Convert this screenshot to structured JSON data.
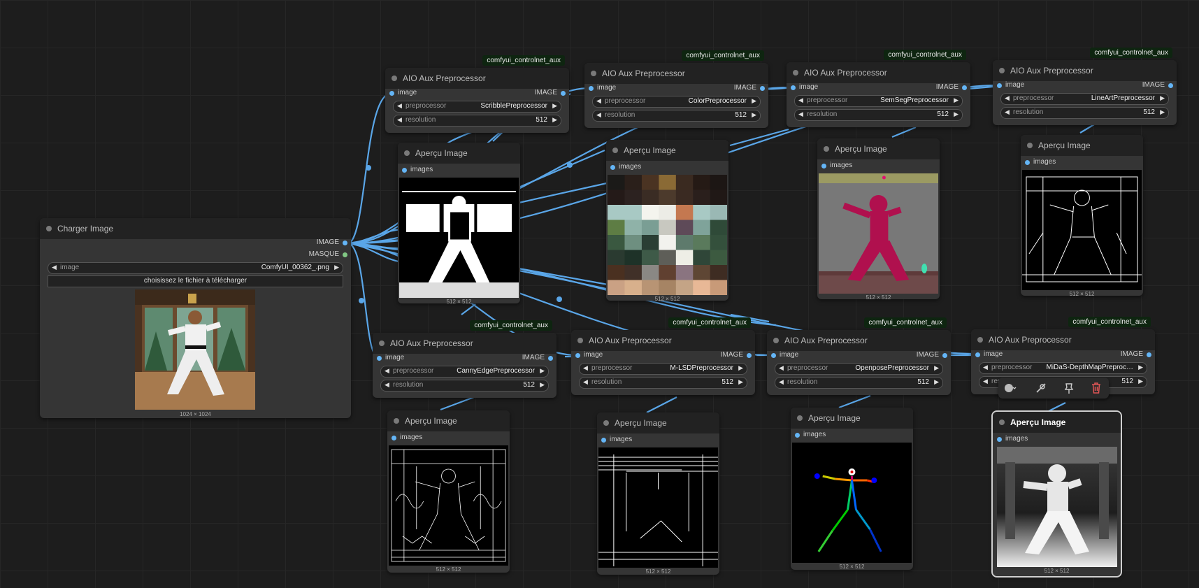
{
  "canvas": {
    "theme": "dark",
    "link_color": "#5aa6e8"
  },
  "loader": {
    "title": "Charger Image",
    "out_image": "IMAGE",
    "out_mask": "MASQUE",
    "widget_name": "image",
    "widget_value": "ComfyUI_00362_.png",
    "upload_label": "choisissez le fichier à télécharger",
    "dims": "1024 × 1024"
  },
  "nodes": [
    {
      "badge": "comfyui_controlnet_aux",
      "title": "AIO Aux Preprocessor",
      "in_label": "image",
      "out_label": "IMAGE",
      "pre_name": "preprocessor",
      "pre_value": "ScribblePreprocessor",
      "res_name": "resolution",
      "res_value": "512"
    },
    {
      "badge": "comfyui_controlnet_aux",
      "title": "AIO Aux Preprocessor",
      "in_label": "image",
      "out_label": "IMAGE",
      "pre_name": "preprocessor",
      "pre_value": "ColorPreprocessor",
      "res_name": "resolution",
      "res_value": "512"
    },
    {
      "badge": "comfyui_controlnet_aux",
      "title": "AIO Aux Preprocessor",
      "in_label": "image",
      "out_label": "IMAGE",
      "pre_name": "preprocessor",
      "pre_value": "SemSegPreprocessor",
      "res_name": "resolution",
      "res_value": "512"
    },
    {
      "badge": "comfyui_controlnet_aux",
      "title": "AIO Aux Preprocessor",
      "in_label": "image",
      "out_label": "IMAGE",
      "pre_name": "preprocessor",
      "pre_value": "LineArtPreprocessor",
      "res_name": "resolution",
      "res_value": "512"
    },
    {
      "badge": "comfyui_controlnet_aux",
      "title": "AIO Aux Preprocessor",
      "in_label": "image",
      "out_label": "IMAGE",
      "pre_name": "preprocessor",
      "pre_value": "CannyEdgePreprocessor",
      "res_name": "resolution",
      "res_value": "512"
    },
    {
      "badge": "comfyui_controlnet_aux",
      "title": "AIO Aux Preprocessor",
      "in_label": "image",
      "out_label": "IMAGE",
      "pre_name": "preprocessor",
      "pre_value": "M-LSDPreprocessor",
      "res_name": "resolution",
      "res_value": "512"
    },
    {
      "badge": "comfyui_controlnet_aux",
      "title": "AIO Aux Preprocessor",
      "in_label": "image",
      "out_label": "IMAGE",
      "pre_name": "preprocessor",
      "pre_value": "OpenposePreprocessor",
      "res_name": "resolution",
      "res_value": "512"
    },
    {
      "badge": "comfyui_controlnet_aux",
      "title": "AIO Aux Preprocessor",
      "in_label": "image",
      "out_label": "IMAGE",
      "pre_name": "preprocessor",
      "pre_value": "MiDaS-DepthMapPreproc…",
      "res_name": "resolution",
      "res_value": "512"
    }
  ],
  "previews": [
    {
      "title": "Aperçu Image",
      "in_label": "images",
      "dims": "512 × 512"
    },
    {
      "title": "Aperçu Image",
      "in_label": "images",
      "dims": "512 × 512"
    },
    {
      "title": "Aperçu Image",
      "in_label": "images",
      "dims": "512 × 512"
    },
    {
      "title": "Aperçu Image",
      "in_label": "images",
      "dims": "512 × 512"
    },
    {
      "title": "Aperçu Image",
      "in_label": "images",
      "dims": "512 × 512"
    },
    {
      "title": "Aperçu Image",
      "in_label": "images",
      "dims": "512 × 512"
    },
    {
      "title": "Aperçu Image",
      "in_label": "images",
      "dims": "512 × 512"
    },
    {
      "title": "Aperçu Image",
      "in_label": "images",
      "dims": "512 × 512"
    }
  ],
  "toolbar": {
    "icons": [
      "color-picker-icon",
      "bypass-icon",
      "pin-icon",
      "delete-icon"
    ],
    "delete_color": "#e05555"
  }
}
